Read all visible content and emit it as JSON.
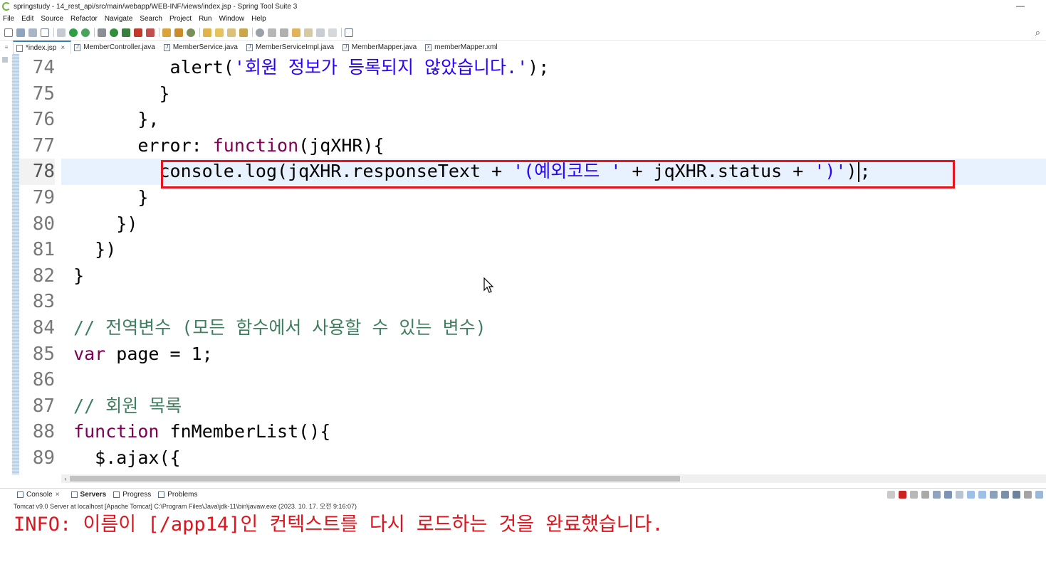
{
  "window": {
    "title": "springstudy - 14_rest_api/src/main/webapp/WEB-INF/views/index.jsp - Spring Tool Suite 3",
    "minimize": "—"
  },
  "menu": [
    "File",
    "Edit",
    "Source",
    "Refactor",
    "Navigate",
    "Search",
    "Project",
    "Run",
    "Window",
    "Help"
  ],
  "toolbar": {
    "search_icon": "search-icon"
  },
  "tabs": [
    {
      "label": "*index.jsp",
      "icon": "jsp-file-icon",
      "active": true,
      "close": "×"
    },
    {
      "label": "MemberController.java",
      "icon": "java-file-icon",
      "active": false
    },
    {
      "label": "MemberService.java",
      "icon": "java-file-icon",
      "active": false
    },
    {
      "label": "MemberServiceImpl.java",
      "icon": "java-file-icon",
      "active": false
    },
    {
      "label": "MemberMapper.java",
      "icon": "java-file-icon",
      "active": false
    },
    {
      "label": "memberMapper.xml",
      "icon": "xml-file-icon",
      "active": false
    }
  ],
  "editor": {
    "current_line": 78,
    "lines": [
      {
        "num": "74",
        "indent": "          ",
        "text": ""
      },
      {
        "num": "75",
        "indent": "         ",
        "text": "}"
      },
      {
        "num": "76",
        "indent": "       ",
        "text": "},"
      },
      {
        "num": "77",
        "indent": "       ",
        "text": ""
      },
      {
        "num": "78",
        "indent": "         ",
        "text": ""
      },
      {
        "num": "79",
        "indent": "       ",
        "text": "}"
      },
      {
        "num": "80",
        "indent": "     ",
        "text": "})"
      },
      {
        "num": "81",
        "indent": "   ",
        "text": "})"
      },
      {
        "num": "82",
        "indent": " ",
        "text": "}"
      },
      {
        "num": "83",
        "indent": "",
        "text": ""
      },
      {
        "num": "84",
        "indent": " ",
        "text": ""
      },
      {
        "num": "85",
        "indent": " ",
        "text": ""
      },
      {
        "num": "86",
        "indent": "",
        "text": ""
      },
      {
        "num": "87",
        "indent": " ",
        "text": ""
      },
      {
        "num": "88",
        "indent": " ",
        "text": ""
      },
      {
        "num": "89",
        "indent": "   ",
        "text": "$.ajax({"
      }
    ],
    "l74": {
      "a": "alert(",
      "b": "'회원 정보가 등록되지 않았습니다.'",
      "c": ");"
    },
    "l77": {
      "a": "error: ",
      "b": "function",
      "c": "(jqXHR){"
    },
    "l78": {
      "a": "console.log(",
      "b": "jqXHR.responseText + ",
      "c": "'(예외코드 '",
      "d": " + jqXHR.status + ",
      "e": "')'",
      "f": ")",
      "g": ";"
    },
    "l84": {
      "a": "// 전역변수 (모든 함수에서 사용할 수 있는 변수)"
    },
    "l85": {
      "a": "var",
      "b": " page = 1;"
    },
    "l87": {
      "a": "// 회원 목록"
    },
    "l88": {
      "a": "function",
      "b": " fnMemberList(){"
    }
  },
  "console": {
    "tabs": [
      {
        "label": "Console",
        "icon": "console-icon",
        "active": false,
        "close": "×"
      },
      {
        "label": "Servers",
        "icon": "servers-icon",
        "active": true
      },
      {
        "label": "Progress",
        "icon": "progress-icon",
        "active": false
      },
      {
        "label": "Problems",
        "icon": "problems-icon",
        "active": false
      }
    ],
    "description": "Tomcat v9.0 Server at localhost [Apache Tomcat] C:\\Program Files\\Java\\jdk-11\\bin\\javaw.exe  (2023. 10. 17. 오전 9:16:07)",
    "output": "INFO: 이름이 [/app14]인 컨텍스트를 다시 로드하는 것을 완료했습니다."
  },
  "colors": {
    "keyword": "#7f0055",
    "string": "#2a00ff",
    "comment": "#3f7f5f",
    "highlight": "#e8f2fe",
    "annotation_box": "#e8141d",
    "console_error": "#e0141d"
  }
}
